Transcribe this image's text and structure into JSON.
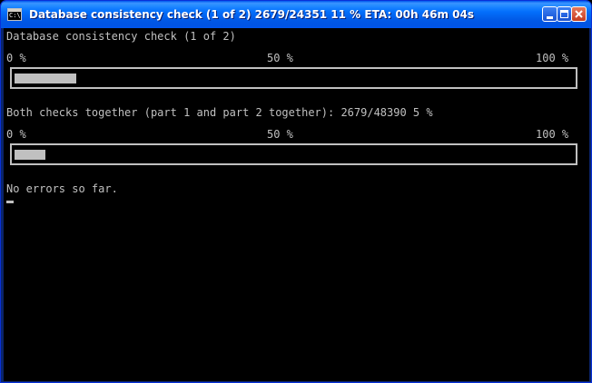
{
  "window": {
    "title": "Database consistency check (1 of 2) 2679/24351 11 %   ETA: 00h 46m 04s",
    "icon": "console-icon",
    "icon_glyph": "C:\\",
    "controls": [
      "minimize-icon",
      "maximize-icon",
      "close-icon"
    ]
  },
  "console": {
    "heading": "Database consistency check (1 of 2)",
    "scale": {
      "min": "0 %",
      "mid": "50 %",
      "max": "100 %"
    },
    "progress1": {
      "percent": 11
    },
    "both_checks": "Both checks together (part 1 and part 2 together): 2679/48390 5 %",
    "progress2": {
      "percent": 5.5
    },
    "status": "No errors so far."
  },
  "colors": {
    "console_background": "#000000",
    "console_text": "#c0c0c0",
    "titlebar": "#0054e3"
  }
}
